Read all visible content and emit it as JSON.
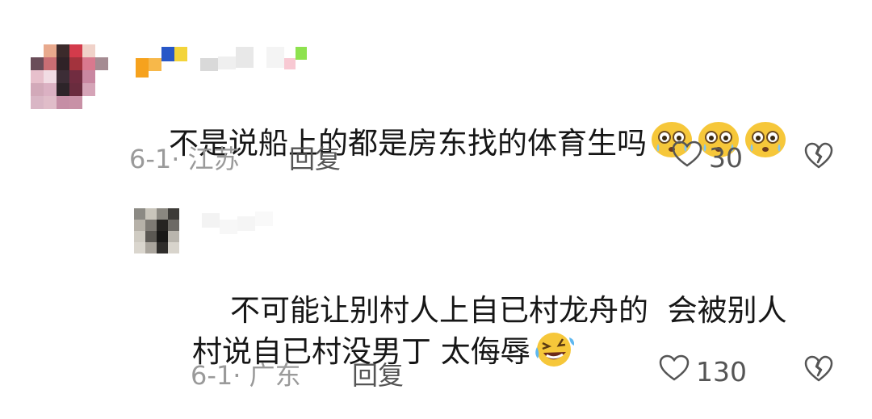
{
  "comments": [
    {
      "text": "不是说船上的都是房东找的体育生吗",
      "emojis": [
        "shocked-tear-face",
        "shocked-tear-face",
        "shocked-tear-face"
      ],
      "date_location": "6-1· 江苏",
      "reply_label": "回复",
      "likes": "30"
    }
  ],
  "replies": [
    {
      "text": "不可能让别村人上自已村龙舟的  会被别人\n村说自已村没男丁 太侮辱",
      "emojis": [
        "rolling-laughing-face"
      ],
      "date_location": "6-1· 广东",
      "reply_label": "回复",
      "likes": "130"
    }
  ],
  "colors": {
    "text": "#161616",
    "meta": "#9a9a9a",
    "icon": "#555555",
    "emoji_yellow": "#f6c73a"
  }
}
